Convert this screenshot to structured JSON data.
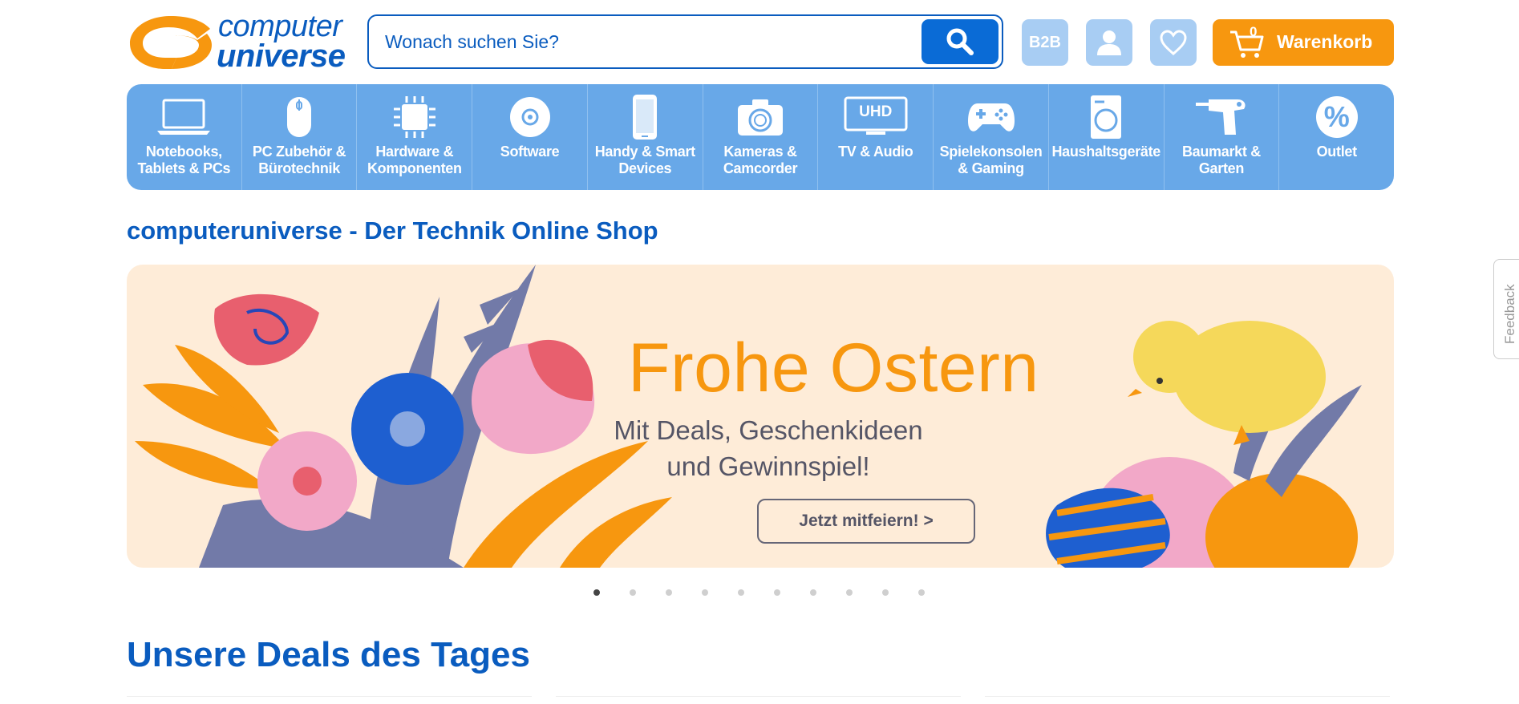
{
  "header": {
    "logo_line1": "computer",
    "logo_line2": "universe",
    "search_placeholder": "Wonach suchen Sie?",
    "b2b_label": "B2B",
    "cart_count": "0",
    "cart_label": "Warenkorb"
  },
  "categories": [
    {
      "label": "Notebooks, Tablets & PCs",
      "icon": "laptop-icon"
    },
    {
      "label": "PC Zubehör & Bürotechnik",
      "icon": "mouse-icon"
    },
    {
      "label": "Hardware & Komponenten",
      "icon": "chip-icon"
    },
    {
      "label": "Software",
      "icon": "disc-icon"
    },
    {
      "label": "Handy & Smart Devices",
      "icon": "phone-icon"
    },
    {
      "label": "Kameras & Camcorder",
      "icon": "camera-icon"
    },
    {
      "label": "TV & Audio",
      "icon": "tv-icon",
      "icon_text": "UHD"
    },
    {
      "label": "Spielekonsolen & Gaming",
      "icon": "gamepad-icon"
    },
    {
      "label": "Haushaltsgeräte",
      "icon": "washing-machine-icon"
    },
    {
      "label": "Baumarkt & Garten",
      "icon": "drill-icon"
    },
    {
      "label": "Outlet",
      "icon": "percent-icon",
      "icon_text": "%"
    }
  ],
  "main": {
    "page_heading": "computeruniverse - Der Technik Online Shop",
    "banner": {
      "title": "Frohe Ostern",
      "subtitle_line1": "Mit Deals, Geschenkideen",
      "subtitle_line2": "und Gewinnspiel!",
      "cta": "Jetzt mitfeiern! >"
    },
    "carousel": {
      "total": 10,
      "active": 1
    },
    "deals_heading": "Unsere Deals des Tages"
  },
  "feedback_label": "Feedback",
  "colors": {
    "brand_blue": "#0a5cbf",
    "category_bar": "#68a8e8",
    "cart_orange": "#f7970f",
    "banner_bg": "#feecd8"
  }
}
